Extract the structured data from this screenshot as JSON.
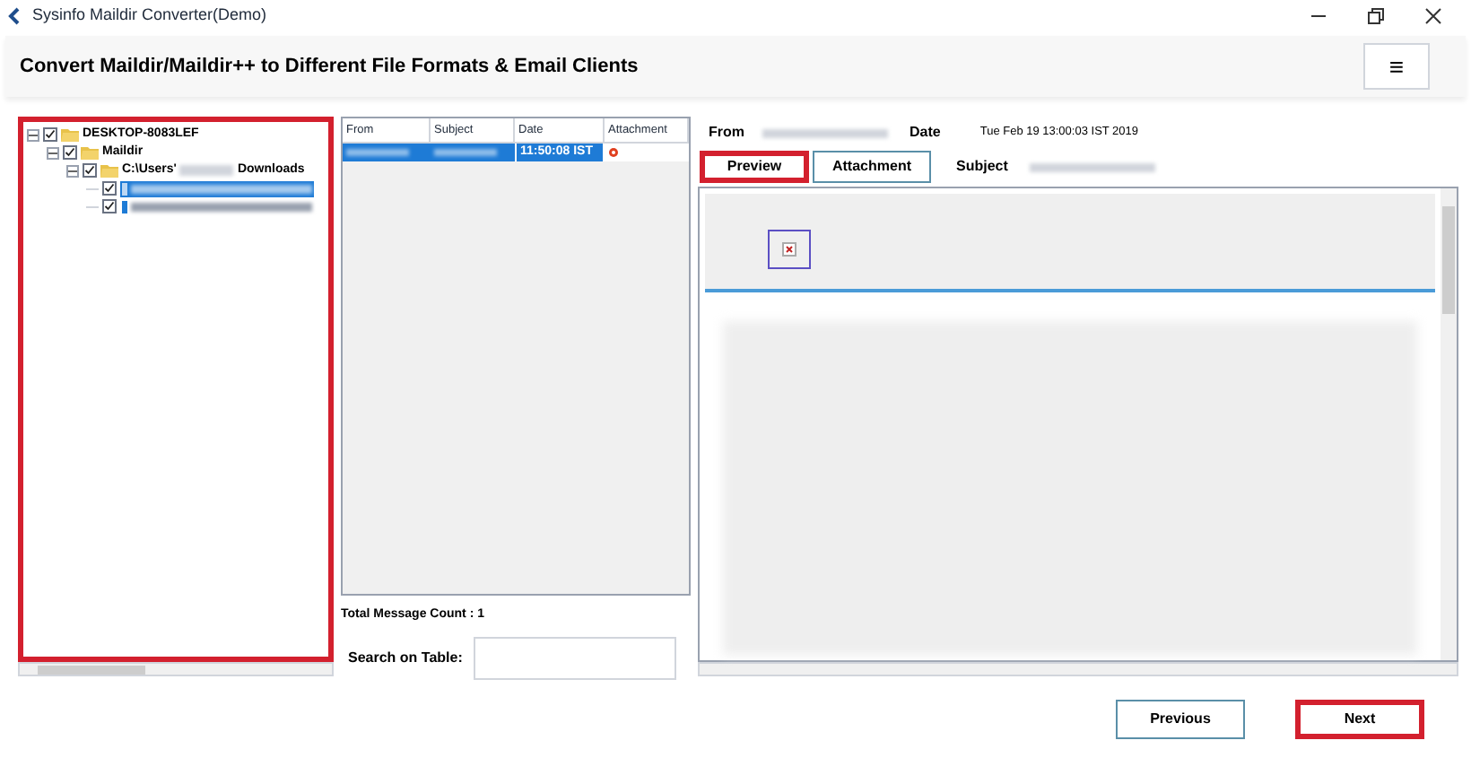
{
  "window": {
    "title": "Sysinfo Maildir Converter(Demo)"
  },
  "header": {
    "title": "Convert Maildir/Maildir++ to Different File Formats & Email Clients",
    "menu_icon": "≡"
  },
  "tree": [
    {
      "label": "DESKTOP-8083LEF",
      "checked": true,
      "expanded": true,
      "children": [
        {
          "label": "Maildir",
          "checked": true,
          "expanded": true,
          "children": [
            {
              "label": "C:\\Users'",
              "label_end": "Downloads",
              "checked": true,
              "expanded": true,
              "children": [
                {
                  "checked": true,
                  "selected": true
                },
                {
                  "checked": true,
                  "selected": false
                }
              ]
            }
          ]
        }
      ]
    }
  ],
  "table": {
    "columns": [
      "From",
      "Subject",
      "Date",
      "Attachment"
    ],
    "rows": [
      {
        "date": "11:50:08 IST",
        "selected": true
      }
    ]
  },
  "total_count": "Total Message Count : 1",
  "search": {
    "label": "Search on Table:"
  },
  "preview": {
    "from_label": "From",
    "date_label": "Date",
    "date": "Tue Feb 19 13:00:03 IST 2019",
    "subject_label": "Subject",
    "tabs": [
      {
        "label": "Preview",
        "selected": true
      },
      {
        "label": "Attachment",
        "selected": false
      }
    ]
  },
  "buttons": [
    {
      "label": "Previous",
      "highlighted": false
    },
    {
      "label": "Next",
      "highlighted": true
    }
  ],
  "highlights": {
    "tree": true,
    "preview_tab": true
  }
}
